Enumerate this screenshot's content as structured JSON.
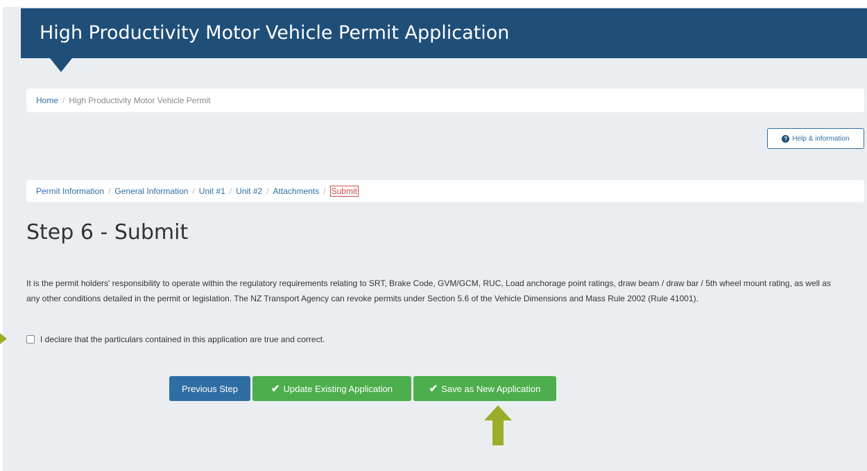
{
  "header": {
    "title": "High Productivity Motor Vehicle Permit Application"
  },
  "breadcrumb": {
    "home": "Home",
    "separator": "/",
    "current": "High Productivity Motor Vehicle Permit"
  },
  "help_button": {
    "icon": "question-icon",
    "label": "Help & information"
  },
  "steps": {
    "separator": "/",
    "items": [
      {
        "label": "Permit Information"
      },
      {
        "label": "General Information"
      },
      {
        "label": "Unit #1"
      },
      {
        "label": "Unit #2"
      },
      {
        "label": "Attachments"
      }
    ],
    "current": "Submit"
  },
  "page": {
    "heading": "Step 6 - Submit",
    "disclaimer": "It is the permit holders' responsibility to operate within the regulatory requirements relating to SRT, Brake Code, GVM/GCM, RUC, Load anchorage point ratings, draw beam / draw bar / 5th wheel mount rating, as well as any other conditions detailed in the permit or legislation. The NZ Transport Agency can revoke permits under Section 5.6 of the Vehicle Dimensions and Mass Rule 2002 (Rule 41001).",
    "declaration": "I declare that the particulars contained in this application are true and correct.",
    "declaration_checked": false
  },
  "buttons": {
    "previous": "Previous Step",
    "update": "Update Existing Application",
    "save_new": "Save as New Application",
    "check_icon": "✔"
  },
  "colors": {
    "header": "#1f4e79",
    "primary": "#2f6ea3",
    "success": "#4cae4c",
    "annotation_arrow": "#9cad2a",
    "current_step": "#d04a4a"
  }
}
